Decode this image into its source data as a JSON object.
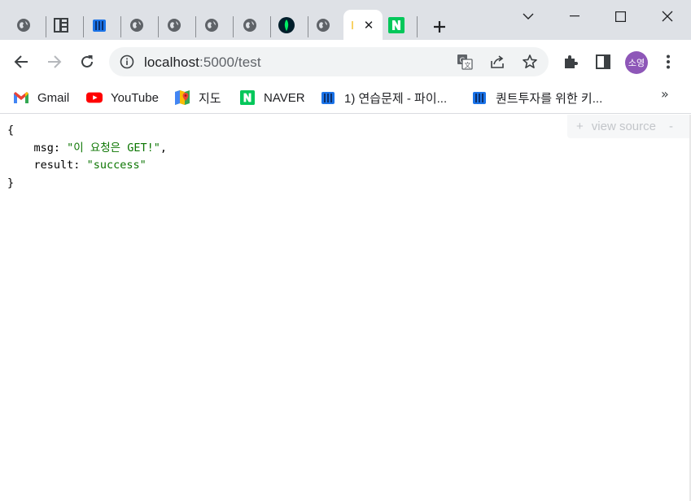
{
  "tabs": [
    {
      "icon": "globe-icon"
    },
    {
      "icon": "book-icon"
    },
    {
      "icon": "wikidocs-icon"
    },
    {
      "icon": "globe-icon"
    },
    {
      "icon": "globe-icon"
    },
    {
      "icon": "globe-icon"
    },
    {
      "icon": "globe-icon"
    },
    {
      "icon": "mongodb-leaf-icon"
    },
    {
      "icon": "globe-icon"
    },
    {
      "icon": "loading-icon",
      "active": true,
      "close": "✕"
    },
    {
      "icon": "naver-icon"
    }
  ],
  "new_tab_label": "+",
  "window_controls": {
    "tab_search": "⌄",
    "minimize": "—",
    "maximize": "□",
    "close": "✕"
  },
  "address_bar": {
    "host": "localhost",
    "rest": ":5000/test"
  },
  "profile": {
    "initials": "소영",
    "color": "#8e57b8"
  },
  "bookmarks": [
    {
      "label": "Gmail",
      "icon": "gmail-icon"
    },
    {
      "label": "YouTube",
      "icon": "youtube-icon"
    },
    {
      "label": "지도",
      "icon": "maps-icon"
    },
    {
      "label": "NAVER",
      "icon": "naver-icon"
    },
    {
      "label": "1) 연습문제 - 파이...",
      "icon": "wikidocs-icon"
    },
    {
      "label": "퀀트투자를 위한 키...",
      "icon": "wikidocs-icon"
    }
  ],
  "bookmarks_more": "»",
  "json_view": {
    "open_brace": "{",
    "close_brace": "}",
    "fields": [
      {
        "key": "msg",
        "value": "\"이 요청은 GET!\"",
        "comma": ","
      },
      {
        "key": "result",
        "value": "\"success\"",
        "comma": ""
      }
    ],
    "view_source": {
      "plus": "+",
      "label": "view source",
      "minus": "-"
    }
  },
  "colors": {
    "string": "#0b7500",
    "tabstrip": "#dee1e6",
    "omnibox": "#f1f3f4"
  }
}
